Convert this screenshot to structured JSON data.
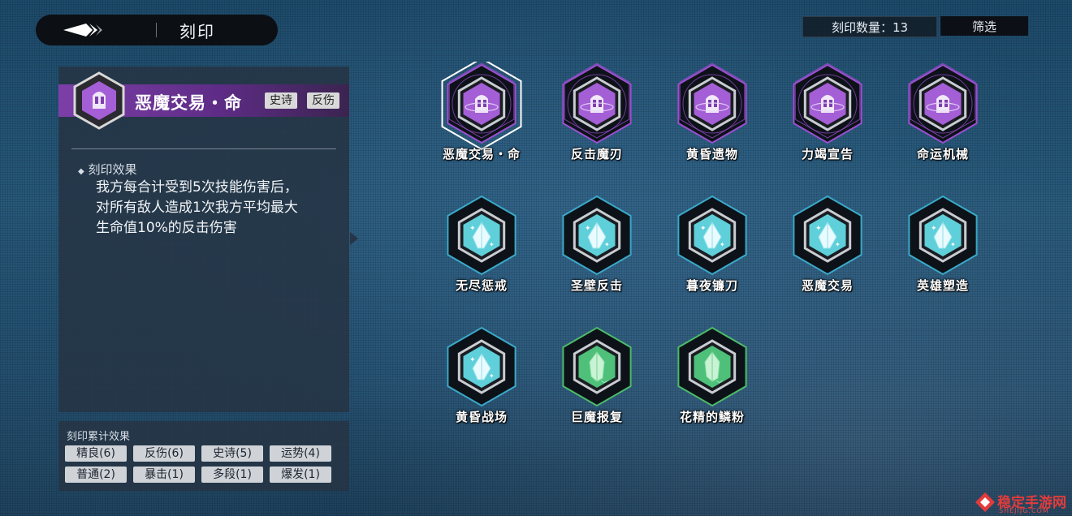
{
  "header": {
    "title": "刻印"
  },
  "top_right": {
    "count_label": "刻印数量：13",
    "filter_label": "筛选"
  },
  "detail": {
    "name": "恶魔交易・命",
    "tags": [
      "史诗",
      "反伤"
    ],
    "effect_label": "刻印效果",
    "effect_lines": [
      "我方每合计受到5次技能伤害后，",
      "对所有敌人造成1次我方平均最大",
      "生命值10%的反击伤害"
    ],
    "rarity_color": "#9b4fd0"
  },
  "summary": {
    "title": "刻印累计效果",
    "stats": [
      "精良(6)",
      "反伤(6)",
      "史诗(5)",
      "运势(4)",
      "普通(2)",
      "暴击(1)",
      "多段(1)",
      "爆发(1)"
    ]
  },
  "items": [
    {
      "name": "恶魔交易・命",
      "rarity": "epic",
      "icon": "helmet-icon",
      "selected": true
    },
    {
      "name": "反击魔刃",
      "rarity": "epic",
      "icon": "helmet-icon",
      "selected": false
    },
    {
      "name": "黄昏遗物",
      "rarity": "epic",
      "icon": "helmet-icon",
      "selected": false
    },
    {
      "name": "力竭宣告",
      "rarity": "epic",
      "icon": "helmet-icon",
      "selected": false
    },
    {
      "name": "命运机械",
      "rarity": "epic",
      "icon": "helmet-icon",
      "selected": false
    },
    {
      "name": "无尽惩戒",
      "rarity": "fine",
      "icon": "crystal-icon",
      "selected": false
    },
    {
      "name": "圣壁反击",
      "rarity": "fine",
      "icon": "crystal-icon",
      "selected": false
    },
    {
      "name": "暮夜镰刀",
      "rarity": "fine",
      "icon": "crystal-icon",
      "selected": false
    },
    {
      "name": "恶魔交易",
      "rarity": "fine",
      "icon": "crystal-icon",
      "selected": false
    },
    {
      "name": "英雄塑造",
      "rarity": "fine",
      "icon": "crystal-icon",
      "selected": false
    },
    {
      "name": "黄昏战场",
      "rarity": "fine",
      "icon": "crystal-icon",
      "selected": false
    },
    {
      "name": "巨魔报复",
      "rarity": "common",
      "icon": "leaf-crystal-icon",
      "selected": false
    },
    {
      "name": "花精的鳞粉",
      "rarity": "common",
      "icon": "leaf-crystal-icon",
      "selected": false
    }
  ],
  "colors": {
    "epic": "#9b4fd0",
    "fine": "#3aa9c9",
    "common": "#4dbb6a"
  },
  "watermark": {
    "text": "稳定手游网",
    "sub": "SHEJIJG.COM"
  }
}
